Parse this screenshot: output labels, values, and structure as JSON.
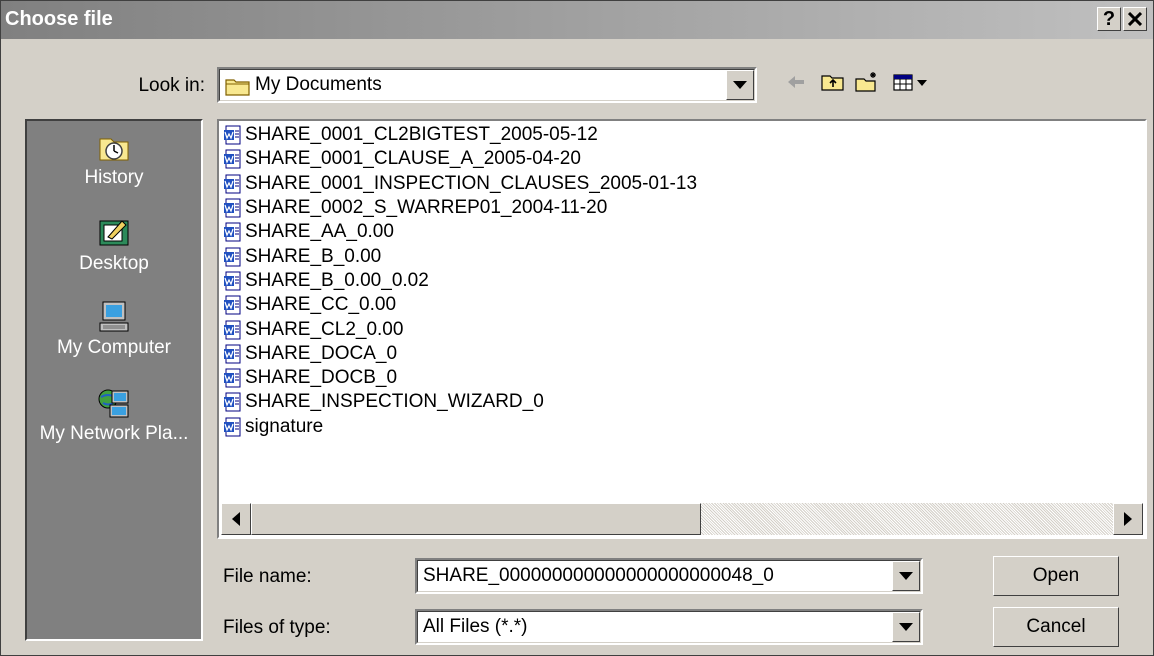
{
  "window": {
    "title": "Choose file",
    "help_label": "?",
    "close_label": "x"
  },
  "lookin": {
    "label": "Look in:",
    "value": "My Documents"
  },
  "toolbar": {
    "icons": [
      "back-arrow-icon",
      "up-folder-icon",
      "new-folder-icon",
      "view-menu-icon"
    ]
  },
  "places": [
    {
      "label": "History",
      "icon": "history-icon"
    },
    {
      "label": "Desktop",
      "icon": "desktop-icon"
    },
    {
      "label": "My Computer",
      "icon": "my-computer-icon"
    },
    {
      "label": "My Network Pla...",
      "icon": "network-places-icon"
    }
  ],
  "files": [
    "SHARE_0001_CL2BIGTEST_2005-05-12",
    "SHARE_0001_CLAUSE_A_2005-04-20",
    "SHARE_0001_INSPECTION_CLAUSES_2005-01-13",
    "SHARE_0002_S_WARREP01_2004-11-20",
    "SHARE_AA_0.00",
    "SHARE_B_0.00",
    "SHARE_B_0.00_0.02",
    "SHARE_CC_0.00",
    "SHARE_CL2_0.00",
    "SHARE_DOCA_0",
    "SHARE_DOCB_0",
    "SHARE_INSPECTION_WIZARD_0",
    "signature"
  ],
  "filename": {
    "label": "File name:",
    "value": "SHARE_000000000000000000000048_0"
  },
  "filetype": {
    "label": "Files of type:",
    "value": "All Files (*.*)"
  },
  "buttons": {
    "open": "Open",
    "cancel": "Cancel"
  }
}
